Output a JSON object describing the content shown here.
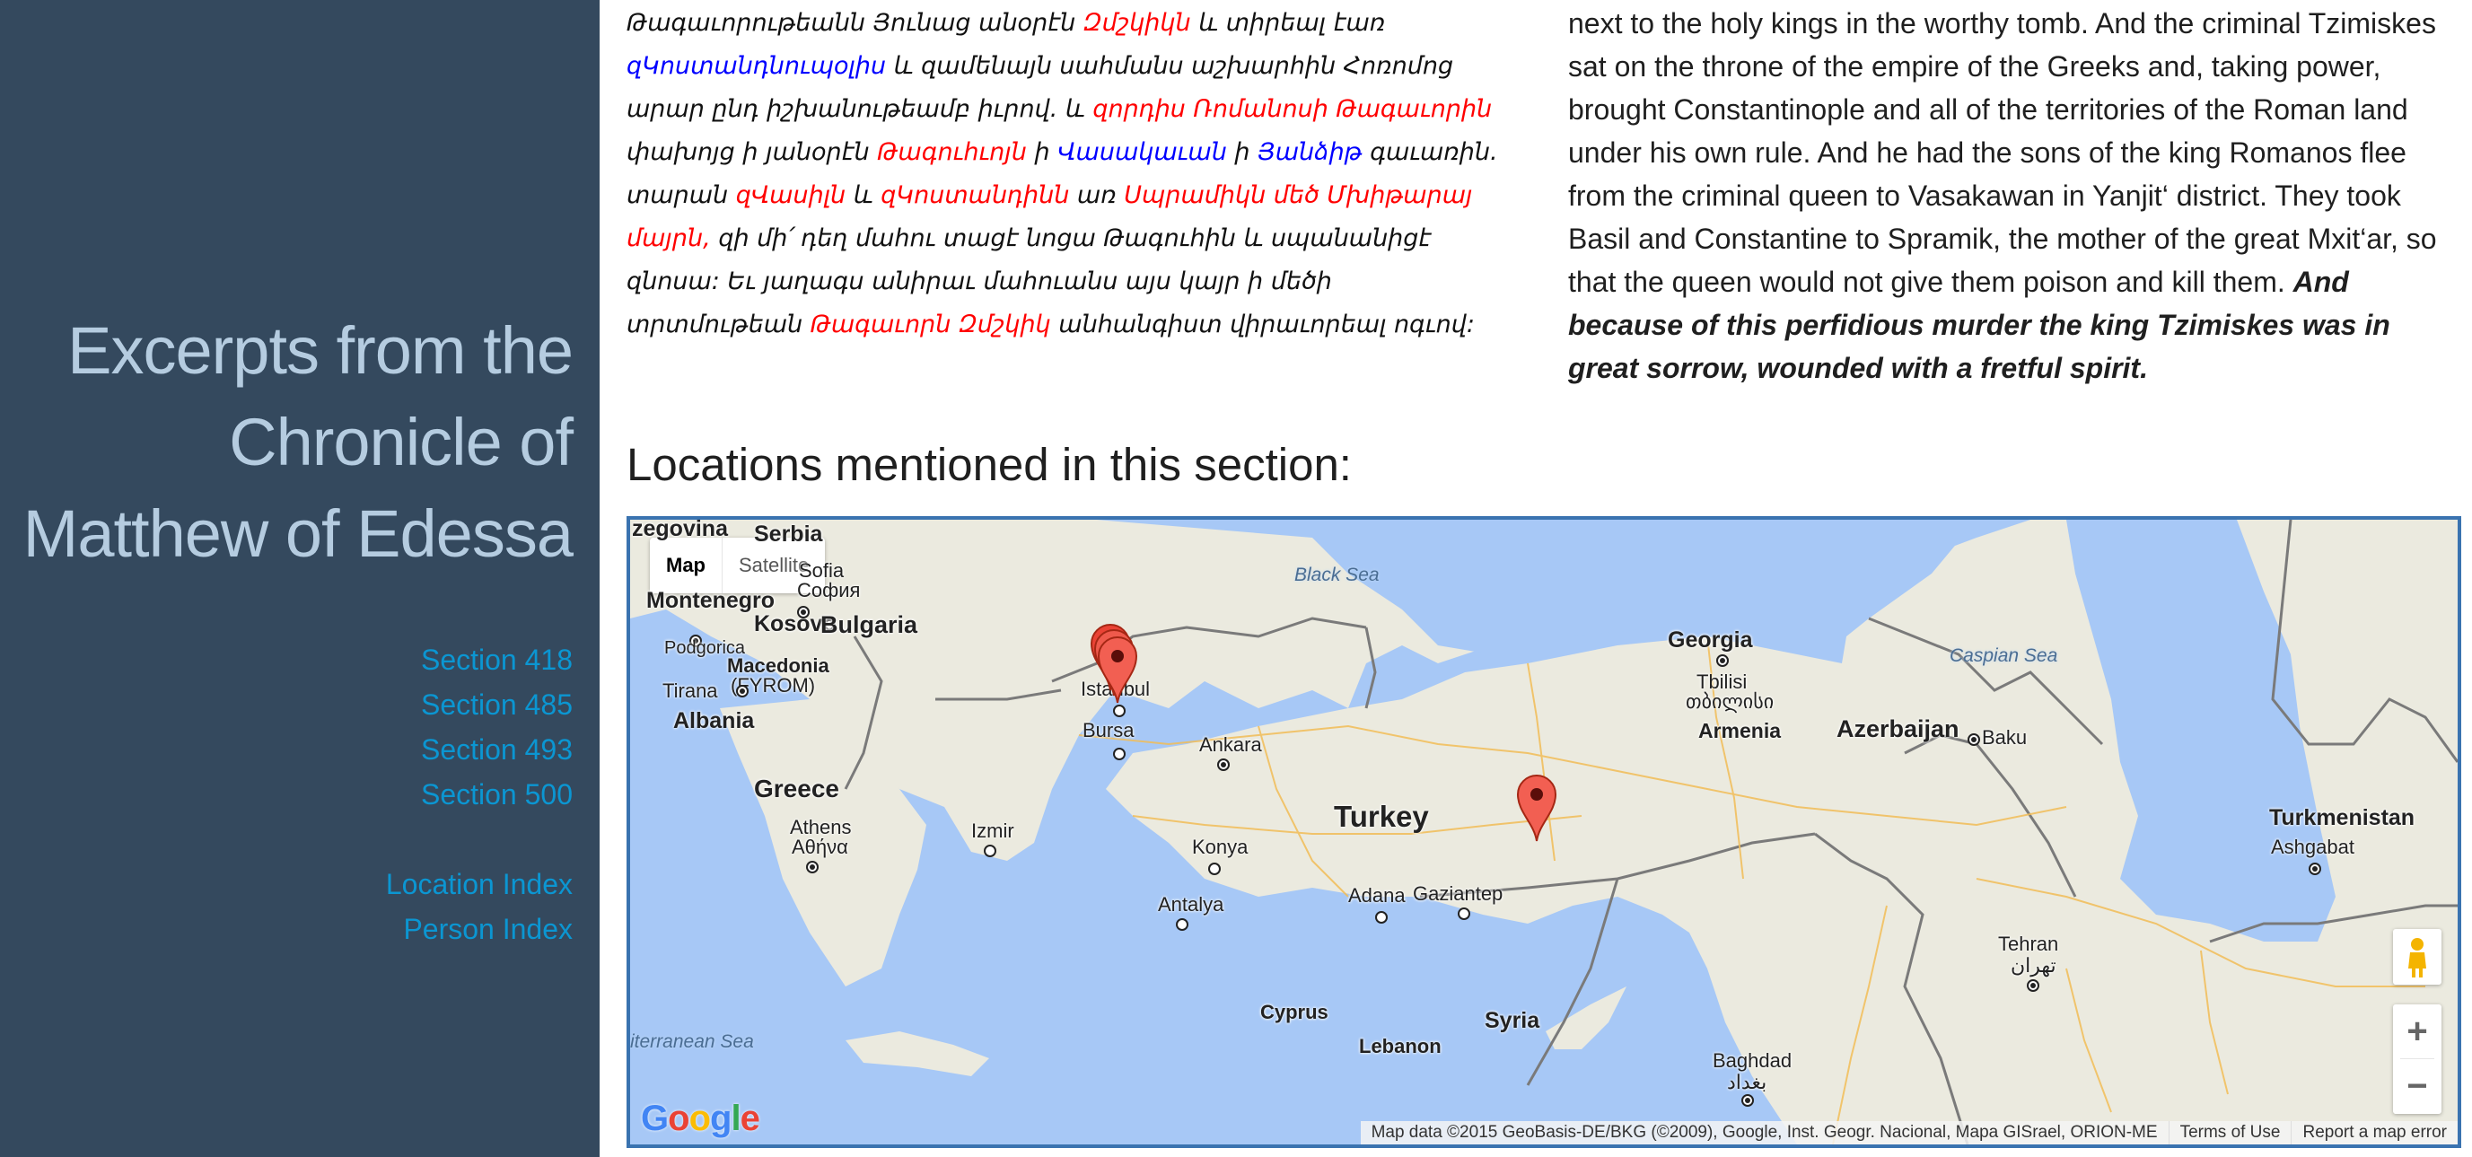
{
  "sidebar": {
    "title_lines": [
      "Excerpts from the",
      "Chronicle of",
      "Matthew of Edessa"
    ],
    "sections": [
      "Section 418",
      "Section 485",
      "Section 493",
      "Section 500"
    ],
    "indexes": [
      "Location Index",
      "Person Index"
    ]
  },
  "armenian": {
    "segments": [
      {
        "t": "Թագաւորութեանն Յունաց անօրէն ",
        "c": ""
      },
      {
        "t": "Զմշկիկն",
        "c": "red"
      },
      {
        "t": " և տիրեալ էառ ",
        "c": ""
      },
      {
        "t": "զԿոստանդնուպօլիս",
        "c": "blue"
      },
      {
        "t": " և զամենայն սահմանս աշխարհին Հոռոմոց արար ընդ իշխանութեամբ իւրով. և ",
        "c": ""
      },
      {
        "t": "զորդիս Ռոմանոսի Թագաւորին",
        "c": "red"
      },
      {
        "t": " փախոյց ի յանօրէն ",
        "c": ""
      },
      {
        "t": "Թագուհւոյն",
        "c": "red"
      },
      {
        "t": " ի ",
        "c": ""
      },
      {
        "t": "Վասակաւան",
        "c": "blue"
      },
      {
        "t": " ի ",
        "c": ""
      },
      {
        "t": "Յանձիթ",
        "c": "blue"
      },
      {
        "t": " գաւառին. տարան ",
        "c": ""
      },
      {
        "t": "զՎասիլն",
        "c": "red"
      },
      {
        "t": " և ",
        "c": ""
      },
      {
        "t": "զԿոստանդինն",
        "c": "red"
      },
      {
        "t": " առ ",
        "c": ""
      },
      {
        "t": "Սպրամիկն մեծ Մխիթարայ մայրն,",
        "c": "red"
      },
      {
        "t": " զի մի՛ դեղ մահու տացէ նոցա Թագուհին և սպանանիցէ զնոսա: Եւ յաղագս անիրաւ մահուանս այս կայր ի մեծի տրտմութեան ",
        "c": ""
      },
      {
        "t": "Թագաւորն Զմշկիկ",
        "c": "red"
      },
      {
        "t": " անհանգիստ վիրաւորեալ ոգւով:",
        "c": ""
      }
    ]
  },
  "english": {
    "normal": "next to the holy kings in the worthy tomb. And the criminal Tzimiskes sat on the throne of the empire of the Greeks and, taking power, brought Constantinople and all of the territories of the Roman land under his own rule. And he had the sons of the king Romanos flee from the criminal queen to Vasakawan in Yanjit‘ district. They took Basil and Constantine to Spramik, the mother of the great Mxit‘ar, so that the queen would not give them poison and kill them. ",
    "emphasis": "And because of this perfidious murder the king Tzimiskes was in great sorrow, wounded with a fretful spirit."
  },
  "locations_heading": "Locations mentioned in this section:",
  "map": {
    "type_control": {
      "map": "Map",
      "satellite": "Satellite",
      "selected": "Map"
    },
    "labels": {
      "herzegovina": "zegovina",
      "serbia": "Serbia",
      "montenegro": "Montenegro",
      "kosovo": "Kosovo",
      "podgorica": "Podgorica",
      "macedonia": "Macedonia",
      "fyrom": "(FYROM)",
      "tirana": "Tirana",
      "albania": "Albania",
      "greece": "Greece",
      "athens": "Athens",
      "athens_gr": "Αθήνα",
      "sofia": "Sofia",
      "sofia_bg": "София",
      "bulgaria": "Bulgaria",
      "black_sea": "Black Sea",
      "istanbul": "Istanbul",
      "bursa": "Bursa",
      "izmir": "Izmir",
      "ankara": "Ankara",
      "konya": "Konya",
      "antalya": "Antalya",
      "turkey": "Turkey",
      "adana": "Adana",
      "gaziantep": "Gaziantep",
      "cyprus": "Cyprus",
      "lebanon": "Lebanon",
      "syria": "Syria",
      "baghdad": "Baghdad",
      "baghdad_ar": "بغداد",
      "georgia": "Georgia",
      "tbilisi": "Tbilisi",
      "tbilisi_ka": "თბილისი",
      "armenia": "Armenia",
      "azerbaijan": "Azerbaijan",
      "baku": "Baku",
      "caspian_sea": "Caspian Sea",
      "turkmenistan": "Turkmenistan",
      "ashgabat": "Ashgabat",
      "tehran": "Tehran",
      "tehran_fa": "تهران",
      "mediterranean": "iterranean Sea"
    },
    "markers": [
      {
        "name": "Constantinople",
        "count": 3
      },
      {
        "name": "Vasakawan",
        "count": 1
      }
    ],
    "attribution": "Map data ©2015 GeoBasis-DE/BKG (©2009), Google, Inst. Geogr. Nacional, Mapa GISrael, ORION-ME",
    "terms": "Terms of Use",
    "report": "Report a map error",
    "zoom_in": "+",
    "zoom_out": "−",
    "logo": [
      "G",
      "o",
      "o",
      "g",
      "l",
      "e"
    ]
  }
}
